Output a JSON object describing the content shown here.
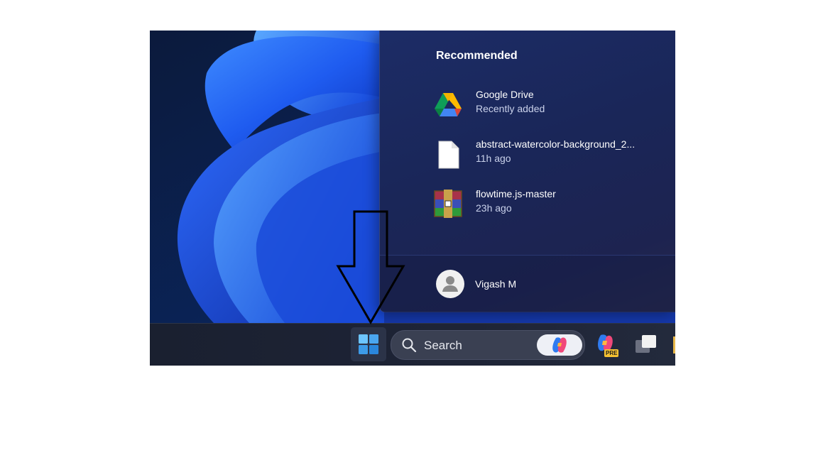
{
  "start_menu": {
    "recommended_heading": "Recommended",
    "items": [
      {
        "name": "Google Drive",
        "detail": "Recently added",
        "icon": "google-drive-icon"
      },
      {
        "name": "abstract-watercolor-background_2...",
        "detail": "11h ago",
        "icon": "document-icon"
      },
      {
        "name": "flowtime.js-master",
        "detail": "23h ago",
        "icon": "winrar-archive-icon"
      }
    ],
    "user": {
      "name": "Vigash M",
      "icon": "user-avatar-icon"
    }
  },
  "taskbar": {
    "start_icon": "windows-start-icon",
    "search": {
      "label": "Search",
      "icon": "search-icon",
      "copilot_icon": "copilot-icon"
    },
    "apps": [
      {
        "icon": "copilot-pre-icon",
        "badge": "PRE"
      },
      {
        "icon": "task-view-icon"
      }
    ]
  },
  "annotation": {
    "icon": "down-arrow-icon"
  },
  "colors": {
    "accent": "#4aa6f0",
    "menu_bg": "#1c2c66",
    "taskbar_bg": "#1e2436"
  }
}
